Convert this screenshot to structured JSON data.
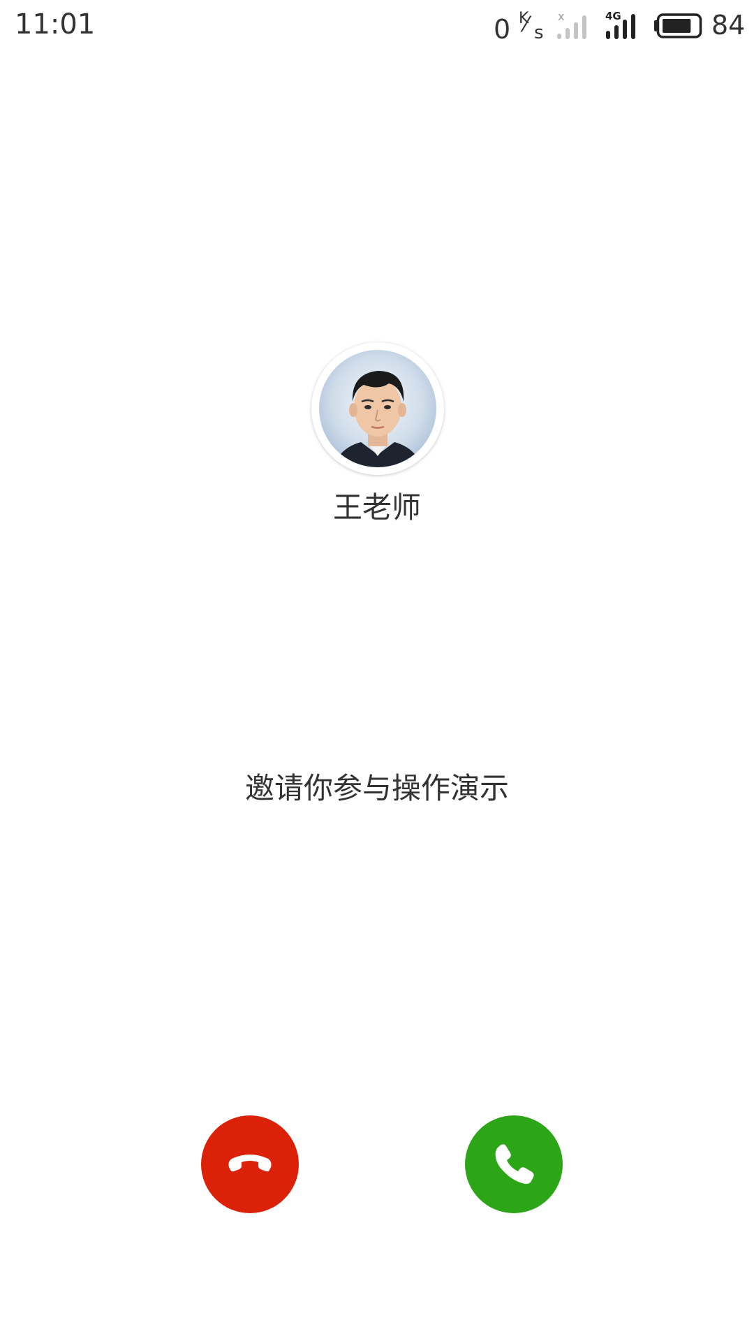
{
  "status_bar": {
    "time": "11:01",
    "net_speed_value": "0",
    "net_speed_unit_top": "K",
    "net_speed_unit_bottom": "s",
    "sim1_status": "x",
    "sim2_network": "4G",
    "battery_percent": "84",
    "battery_level": 0.84
  },
  "caller": {
    "avatar_icon": "caller-photo",
    "name": "王老师",
    "message": "邀请你参与操作演示"
  },
  "actions": {
    "decline": {
      "icon": "hang-up-icon",
      "color": "#dc2109"
    },
    "answer": {
      "icon": "phone-icon",
      "color": "#2ca516"
    }
  }
}
